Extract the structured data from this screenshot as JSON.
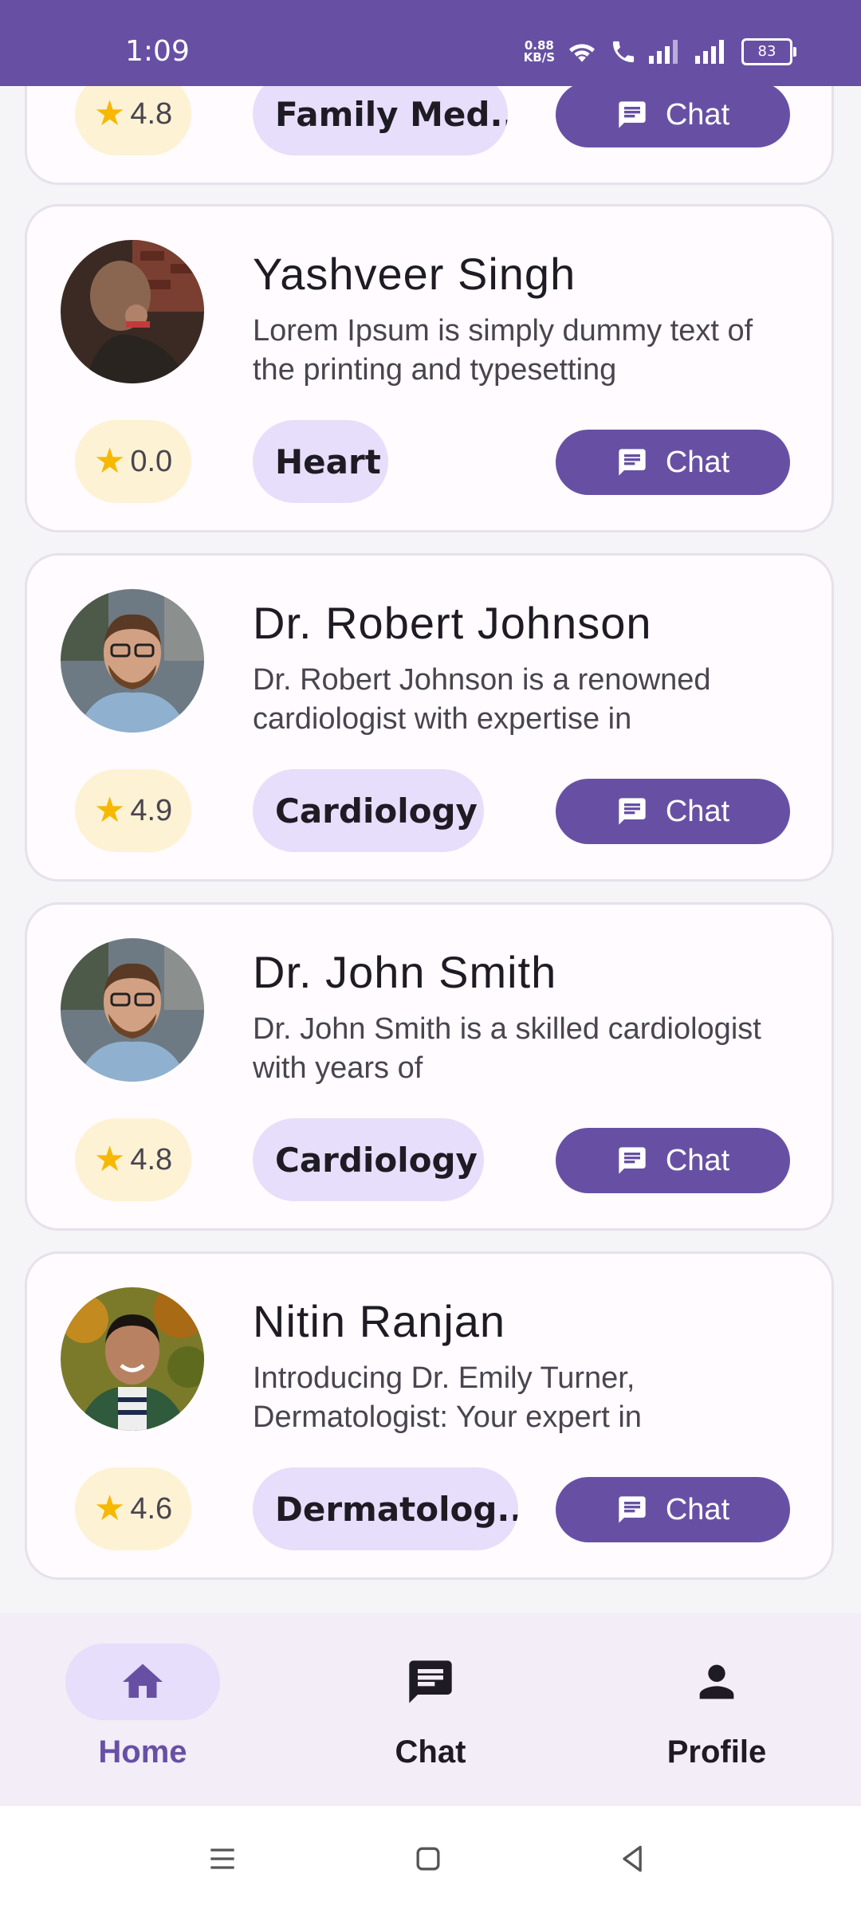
{
  "status_bar": {
    "time": "1:09",
    "net_speed_value": "0.88",
    "net_speed_unit": "KB/S",
    "battery": "83"
  },
  "doctors": [
    {
      "name": "",
      "description": "",
      "rating": "4.8",
      "specialty": "Family Med...",
      "chat_label": "Chat"
    },
    {
      "name": "Yashveer Singh",
      "description": "Lorem Ipsum is simply dummy text of the printing and typesetting",
      "rating": "0.0",
      "specialty": "Heart",
      "chat_label": "Chat"
    },
    {
      "name": "Dr. Robert Johnson",
      "description": "Dr. Robert Johnson is a renowned cardiologist with expertise in",
      "rating": "4.9",
      "specialty": "Cardiology",
      "chat_label": "Chat"
    },
    {
      "name": "Dr. John Smith",
      "description": "Dr. John Smith is a skilled cardiologist with years of",
      "rating": "4.8",
      "specialty": "Cardiology",
      "chat_label": "Chat"
    },
    {
      "name": "Nitin Ranjan",
      "description": " Introducing Dr. Emily Turner, Dermatologist: Your expert in",
      "rating": "4.6",
      "specialty": "Dermatolog...",
      "chat_label": "Chat"
    }
  ],
  "bottom_nav": {
    "items": [
      {
        "label": "Home",
        "icon": "home-icon",
        "active": true
      },
      {
        "label": "Chat",
        "icon": "chat-icon",
        "active": false
      },
      {
        "label": "Profile",
        "icon": "person-icon",
        "active": false
      }
    ]
  },
  "colors": {
    "primary": "#6750a4",
    "tag_bg": "#e6defa",
    "rating_bg": "#fdf2d4",
    "star": "#f6b800"
  }
}
